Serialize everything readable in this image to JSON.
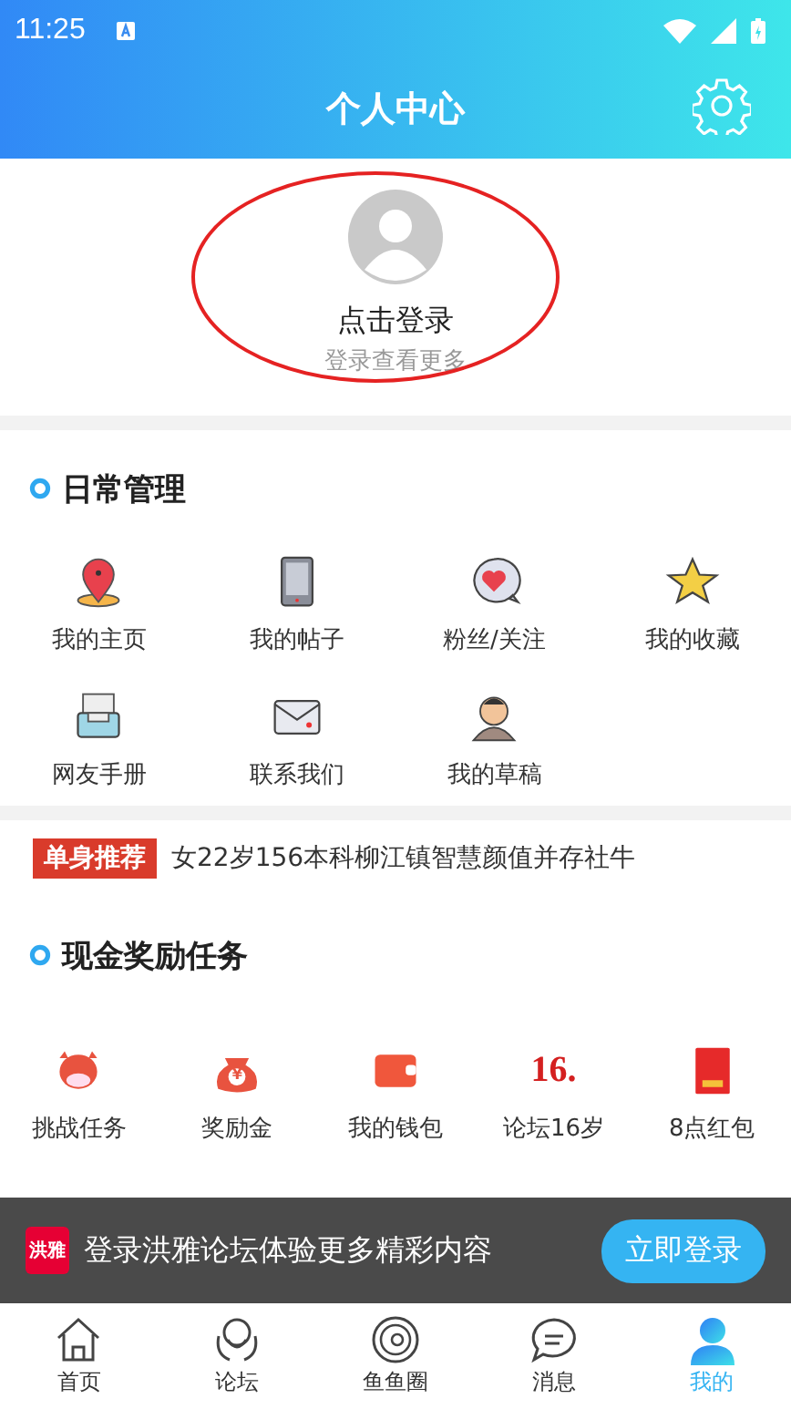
{
  "status_bar": {
    "time": "11:25"
  },
  "header": {
    "title": "个人中心"
  },
  "profile": {
    "login": "点击登录",
    "hint": "登录查看更多"
  },
  "daily": {
    "title": "日常管理",
    "items": [
      {
        "label": "我的主页"
      },
      {
        "label": "我的帖子"
      },
      {
        "label": "粉丝/关注"
      },
      {
        "label": "我的收藏"
      },
      {
        "label": "网友手册"
      },
      {
        "label": "联系我们"
      },
      {
        "label": "我的草稿"
      }
    ]
  },
  "notice": {
    "tag": "单身推荐",
    "text": "女22岁156本科柳江镇智慧颜值并存社牛"
  },
  "tasks": {
    "title": "现金奖励任务",
    "items": [
      {
        "label": "挑战任务",
        "kind": "cow"
      },
      {
        "label": "奖励金",
        "kind": "bag",
        "glyph": "¥"
      },
      {
        "label": "我的钱包",
        "kind": "wallet"
      },
      {
        "label": "论坛16岁",
        "kind": "number",
        "glyph": "16."
      },
      {
        "label": "8点红包",
        "kind": "envelope"
      }
    ]
  },
  "login_banner": {
    "logo": "洪雅",
    "text": "登录洪雅论坛体验更多精彩内容",
    "button": "立即登录"
  },
  "tabs": [
    {
      "label": "首页",
      "selected": false
    },
    {
      "label": "论坛",
      "selected": false
    },
    {
      "label": "鱼鱼圈",
      "selected": false
    },
    {
      "label": "消息",
      "selected": false
    },
    {
      "label": "我的",
      "selected": true
    }
  ]
}
